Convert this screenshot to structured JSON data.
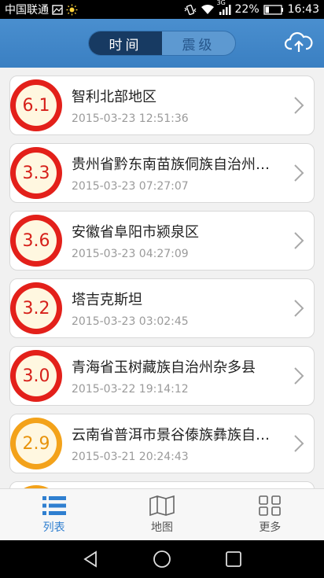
{
  "status_bar": {
    "carrier": "中国联通",
    "network": "3G",
    "battery": "22%",
    "time": "16:43"
  },
  "header": {
    "segments": [
      {
        "label": "时间",
        "active": true
      },
      {
        "label": "震级",
        "active": false
      }
    ],
    "upload_icon": "cloud-upload-icon"
  },
  "quakes": [
    {
      "magnitude": "6.1",
      "place": "智利北部地区",
      "time": "2015-03-23 12:51:36",
      "level": "red"
    },
    {
      "magnitude": "3.3",
      "place": "贵州省黔东南苗族侗族自治州…",
      "time": "2015-03-23 07:27:07",
      "level": "red"
    },
    {
      "magnitude": "3.6",
      "place": "安徽省阜阳市颍泉区",
      "time": "2015-03-23 04:27:09",
      "level": "red"
    },
    {
      "magnitude": "3.2",
      "place": "塔吉克斯坦",
      "time": "2015-03-23 03:02:45",
      "level": "red"
    },
    {
      "magnitude": "3.0",
      "place": "青海省玉树藏族自治州杂多县",
      "time": "2015-03-22 19:14:12",
      "level": "red"
    },
    {
      "magnitude": "2.9",
      "place": "云南省普洱市景谷傣族彝族自…",
      "time": "2015-03-21 20:24:43",
      "level": "orange"
    }
  ],
  "tabs": [
    {
      "label": "列表",
      "icon": "list-icon",
      "active": true
    },
    {
      "label": "地图",
      "icon": "map-icon",
      "active": false
    },
    {
      "label": "更多",
      "icon": "grid-icon",
      "active": false
    }
  ],
  "colors": {
    "header": "#3a7fc2",
    "active_tab": "#2f7fd0",
    "mag_red": "#e3201a",
    "mag_orange": "#f3a21a"
  }
}
